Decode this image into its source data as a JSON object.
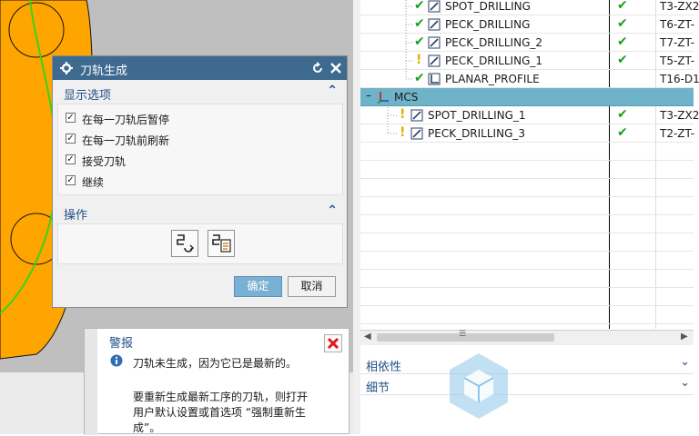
{
  "dialog": {
    "title": "刀轨生成",
    "display_section": {
      "title": "显示选项",
      "options": [
        {
          "label": "在每一刀轨后暂停",
          "checked": true
        },
        {
          "label": "在每一刀轨前刷新",
          "checked": true
        },
        {
          "label": "接受刀轨",
          "checked": true
        },
        {
          "label": "继续",
          "checked": true
        }
      ]
    },
    "operation_section": {
      "title": "操作"
    },
    "ok_label": "确定",
    "cancel_label": "取消"
  },
  "alert": {
    "title": "警报",
    "message": "刀轨未生成，因为它已是最新的。",
    "detail": "要重新生成最新工序的刀轨，则打开用户默认设置或首选项 “强制重新生成”。"
  },
  "tree": {
    "rows": [
      {
        "name": "SPOT_DRILLING",
        "tool": "T3-ZX2",
        "status": "ok",
        "op_status": "ok"
      },
      {
        "name": "PECK_DRILLING",
        "tool": "T6-ZT-",
        "status": "ok",
        "op_status": "ok"
      },
      {
        "name": "PECK_DRILLING_2",
        "tool": "T7-ZT-",
        "status": "ok",
        "op_status": "ok"
      },
      {
        "name": "PECK_DRILLING_1",
        "tool": "T5-ZT-",
        "status": "warn",
        "op_status": "ok"
      },
      {
        "name": "PLANAR_PROFILE",
        "tool": "T16-D1",
        "status": "ok",
        "op_status": ""
      },
      {
        "name": "MCS",
        "tool": "",
        "status": "",
        "op_status": ""
      },
      {
        "name": "SPOT_DRILLING_1",
        "tool": "T3-ZX2",
        "status": "warn",
        "op_status": "ok"
      },
      {
        "name": "PECK_DRILLING_3",
        "tool": "T2-ZT-",
        "status": "warn",
        "op_status": "ok"
      }
    ]
  },
  "panels": {
    "dependencies": "相依性",
    "details": "细节"
  },
  "icons": {
    "settings": "gear-icon",
    "reset": "reset-icon",
    "close": "close-icon",
    "collapse": "chevron-up-icon",
    "expand": "chevron-down-icon",
    "alert_info": "info-icon",
    "alert_close": "red-x-icon"
  },
  "colors": {
    "title_bar": "#3e6a8f",
    "section_text": "#1f4f86",
    "part_orange": "#ffa500",
    "toolpath_green": "#39d31a",
    "selected_row": "#6fb3c8",
    "ok_button": "#7ab0d4"
  }
}
